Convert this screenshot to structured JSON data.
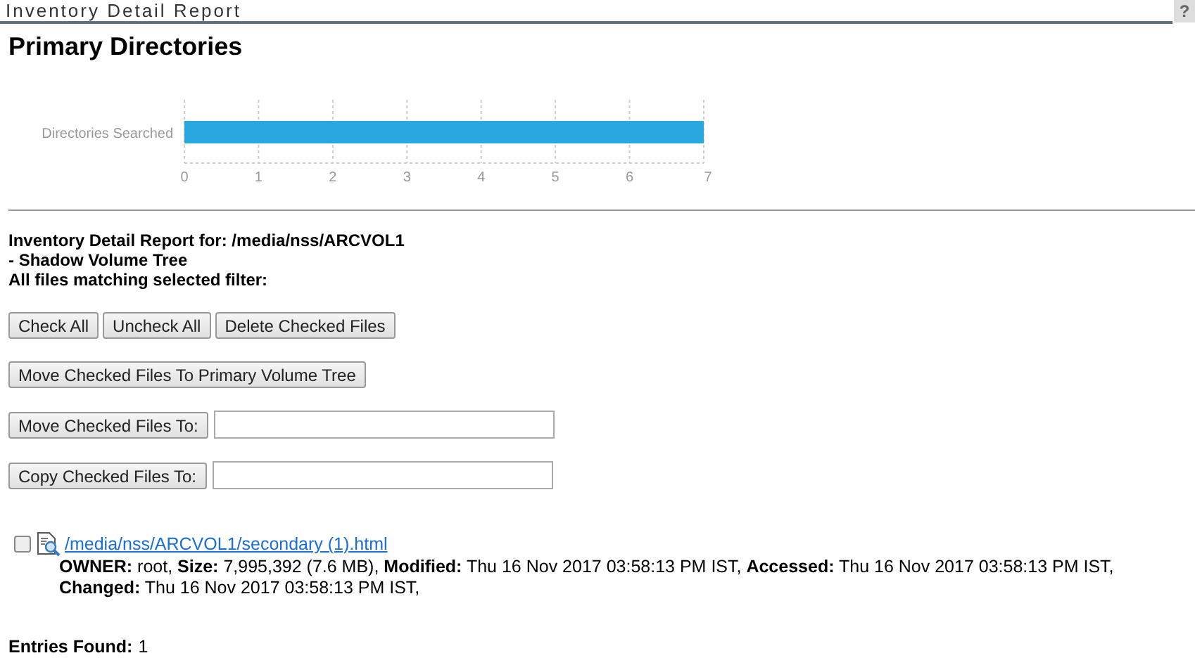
{
  "header": {
    "title": "Inventory Detail Report",
    "help": "?"
  },
  "heading": "Primary Directories",
  "chart": {
    "chart_data": {
      "type": "bar",
      "orientation": "horizontal",
      "categories": [
        "Directories Searched"
      ],
      "series": [
        {
          "color": "#29a8e0",
          "values": [
            7
          ]
        }
      ],
      "xlim": [
        0,
        7
      ],
      "grid": true,
      "xticks": [
        0,
        1,
        2,
        3,
        4,
        5,
        6,
        7
      ]
    }
  },
  "report": {
    "lines": [
      "Inventory Detail Report for: /media/nss/ARCVOL1",
      "- Shadow Volume Tree",
      "All files matching selected filter:"
    ]
  },
  "button_rows": [
    {
      "kind": "buttons",
      "buttons": [
        "Check All",
        "Uncheck All",
        "Delete Checked Files"
      ]
    },
    {
      "kind": "buttons",
      "buttons": [
        "Move Checked Files To Primary Volume Tree"
      ]
    },
    {
      "kind": "buttons_with_field",
      "buttons": [
        "Move Checked Files To:"
      ]
    },
    {
      "kind": "buttons_with_field",
      "buttons": [
        "Copy Checked Files To:"
      ]
    }
  ],
  "files": [
    {
      "checked": false,
      "link": "/media/nss/ARCVOL1/secondary (1).html",
      "details": "**OWNER:** root, **Size:** 7,995,392 (7.6 MB), **Modified:** Thu 16 Nov 2017 03:58:13 PM IST, **Accessed:** Thu 16 Nov 2017 03:58:13 PM IST, **Changed:** Thu 16 Nov 2017 03:58:13 PM IST,"
    }
  ],
  "entries": {
    "label": "Entries Found:",
    "value": "1"
  }
}
